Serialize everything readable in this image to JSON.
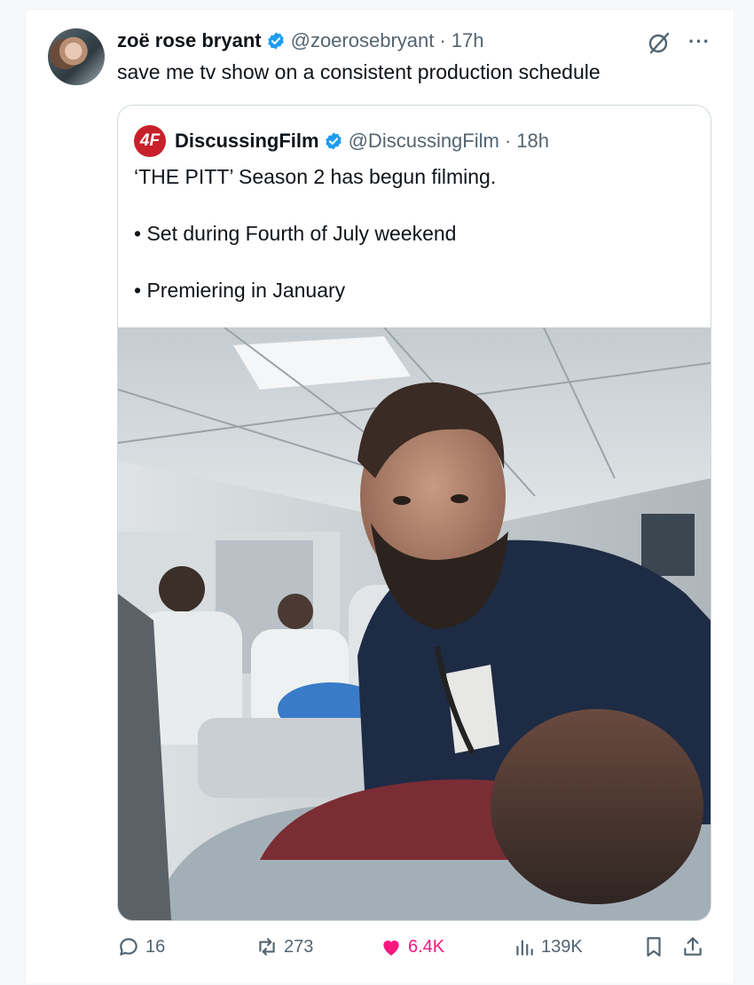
{
  "tweet": {
    "author_name": "zoë rose bryant",
    "handle": "@zoerosebryant",
    "time": "· 17h",
    "text": "save me tv show on a consistent production schedule"
  },
  "quoted": {
    "logo_text": "4F",
    "author_name": "DiscussingFilm",
    "handle": "@DiscussingFilm",
    "time": "· 18h",
    "lines": [
      "‘THE PITT’ Season 2 has begun filming.",
      "• Set during Fourth of July weekend",
      "• Premiering in January"
    ]
  },
  "actions": {
    "replies": "16",
    "reposts": "273",
    "likes": "6.4K",
    "views": "139K"
  },
  "colors": {
    "verified": "#1d9bf0",
    "like": "#f91880",
    "muted": "#536471",
    "logo": "#c8202a"
  },
  "icons": [
    "verified-badge-icon",
    "grok-icon",
    "more-icon",
    "reply-icon",
    "repost-icon",
    "like-icon",
    "views-icon",
    "bookmark-icon",
    "share-icon"
  ]
}
